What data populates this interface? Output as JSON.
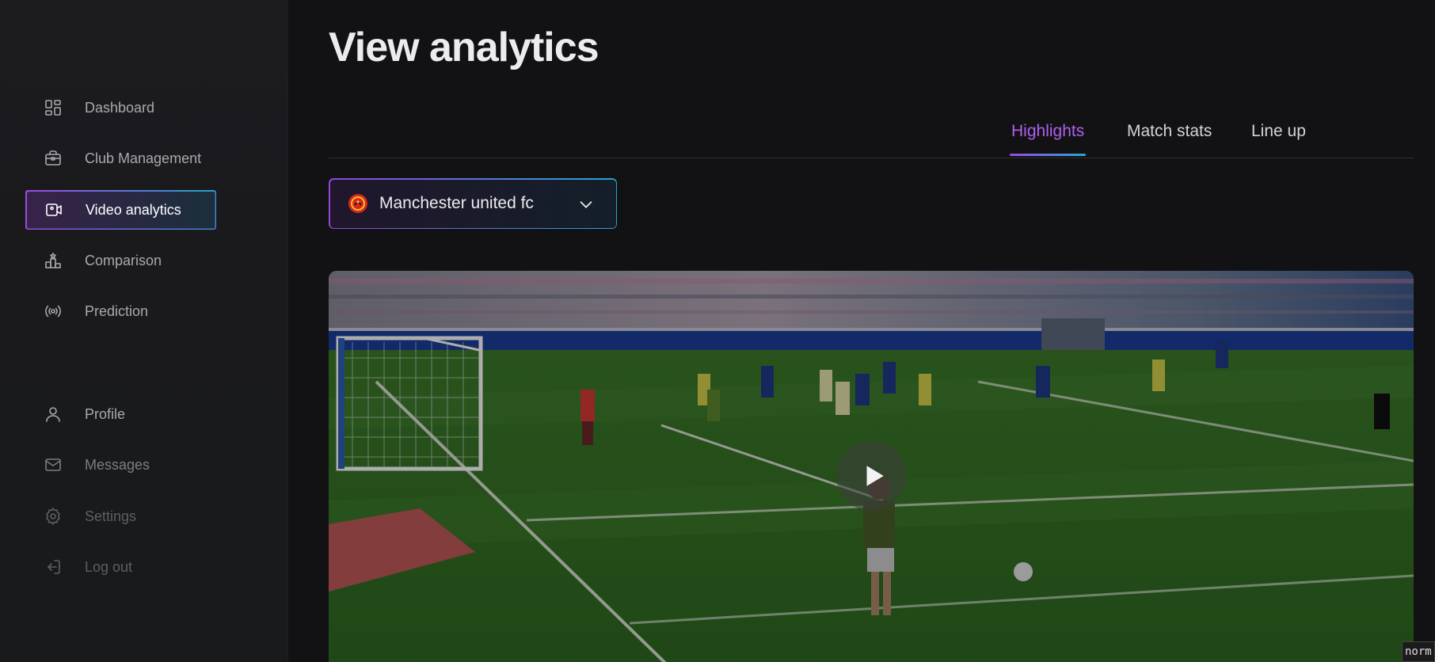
{
  "page": {
    "title": "View analytics"
  },
  "sidebar": {
    "items": [
      {
        "label": "Dashboard",
        "icon": "dashboard-icon"
      },
      {
        "label": "Club Management",
        "icon": "briefcase-icon"
      },
      {
        "label": "Video analytics",
        "icon": "video-icon",
        "active": true
      },
      {
        "label": "Comparison",
        "icon": "podium-icon"
      },
      {
        "label": "Prediction",
        "icon": "broadcast-icon"
      },
      {
        "label": "Profile",
        "icon": "user-icon"
      },
      {
        "label": "Messages",
        "icon": "mail-icon"
      },
      {
        "label": "Settings",
        "icon": "gear-icon"
      },
      {
        "label": "Log out",
        "icon": "logout-icon"
      }
    ]
  },
  "tabs": [
    {
      "label": "Highlights",
      "active": true
    },
    {
      "label": "Match stats"
    },
    {
      "label": "Line up"
    }
  ],
  "club_select": {
    "value": "Manchester united fc",
    "icon": "club-crest-icon"
  },
  "video": {
    "state": "paused",
    "play_icon": "play-icon"
  },
  "corner_tag": "norm",
  "colors": {
    "accent_purple": "#9b4ae6",
    "accent_blue": "#2aa6d4",
    "background": "#121215"
  }
}
